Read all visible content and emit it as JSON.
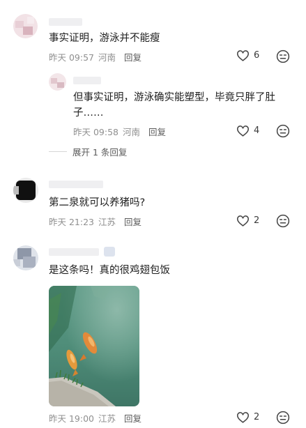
{
  "comments": [
    {
      "text": "事实证明，游泳并不能瘦",
      "time": "昨天 09:57",
      "location": "河南",
      "reply_label": "回复",
      "likes": "6",
      "replies": [
        {
          "text_line1": "但事实证明，游泳确实能塑型，毕竟只胖了肚",
          "text_line2": "子……",
          "time": "昨天 09:58",
          "location": "河南",
          "reply_label": "回复",
          "likes": "4"
        }
      ],
      "expand_label": "展开 1 条回复"
    },
    {
      "text": "第二泉就可以养猪吗?",
      "time": "昨天 21:23",
      "location": "江苏",
      "reply_label": "回复",
      "likes": "2"
    },
    {
      "text": "是这条吗！真的很鸡翅包饭",
      "time": "昨天 19:00",
      "location": "江苏",
      "reply_label": "回复",
      "likes": "2"
    }
  ],
  "icons": {
    "like": "heart-outline-icon",
    "dislike": "expressionless-face-icon"
  }
}
